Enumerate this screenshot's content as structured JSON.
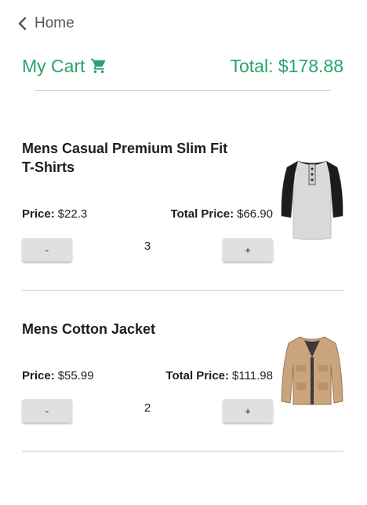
{
  "nav": {
    "back_label": "Home"
  },
  "header": {
    "title": "My Cart",
    "total": "Total: $178.88"
  },
  "items": [
    {
      "title": "Mens Casual Premium Slim Fit T-Shirts",
      "price_label": "Price:",
      "price": "$22.3",
      "total_label": "Total Price:",
      "total": "$66.90",
      "decrement_label": "-",
      "quantity": "3",
      "increment_label": "+",
      "image_icon": "raglan-henley-shirt-image"
    },
    {
      "title": "Mens Cotton Jacket",
      "price_label": "Price:",
      "price": "$55.99",
      "total_label": "Total Price:",
      "total": "$111.98",
      "decrement_label": "-",
      "quantity": "2",
      "increment_label": "+",
      "image_icon": "beige-jacket-image"
    }
  ],
  "colors": {
    "accent": "#27a46a",
    "button_bg": "#e0e0e0",
    "divider": "#cfcfcf"
  }
}
